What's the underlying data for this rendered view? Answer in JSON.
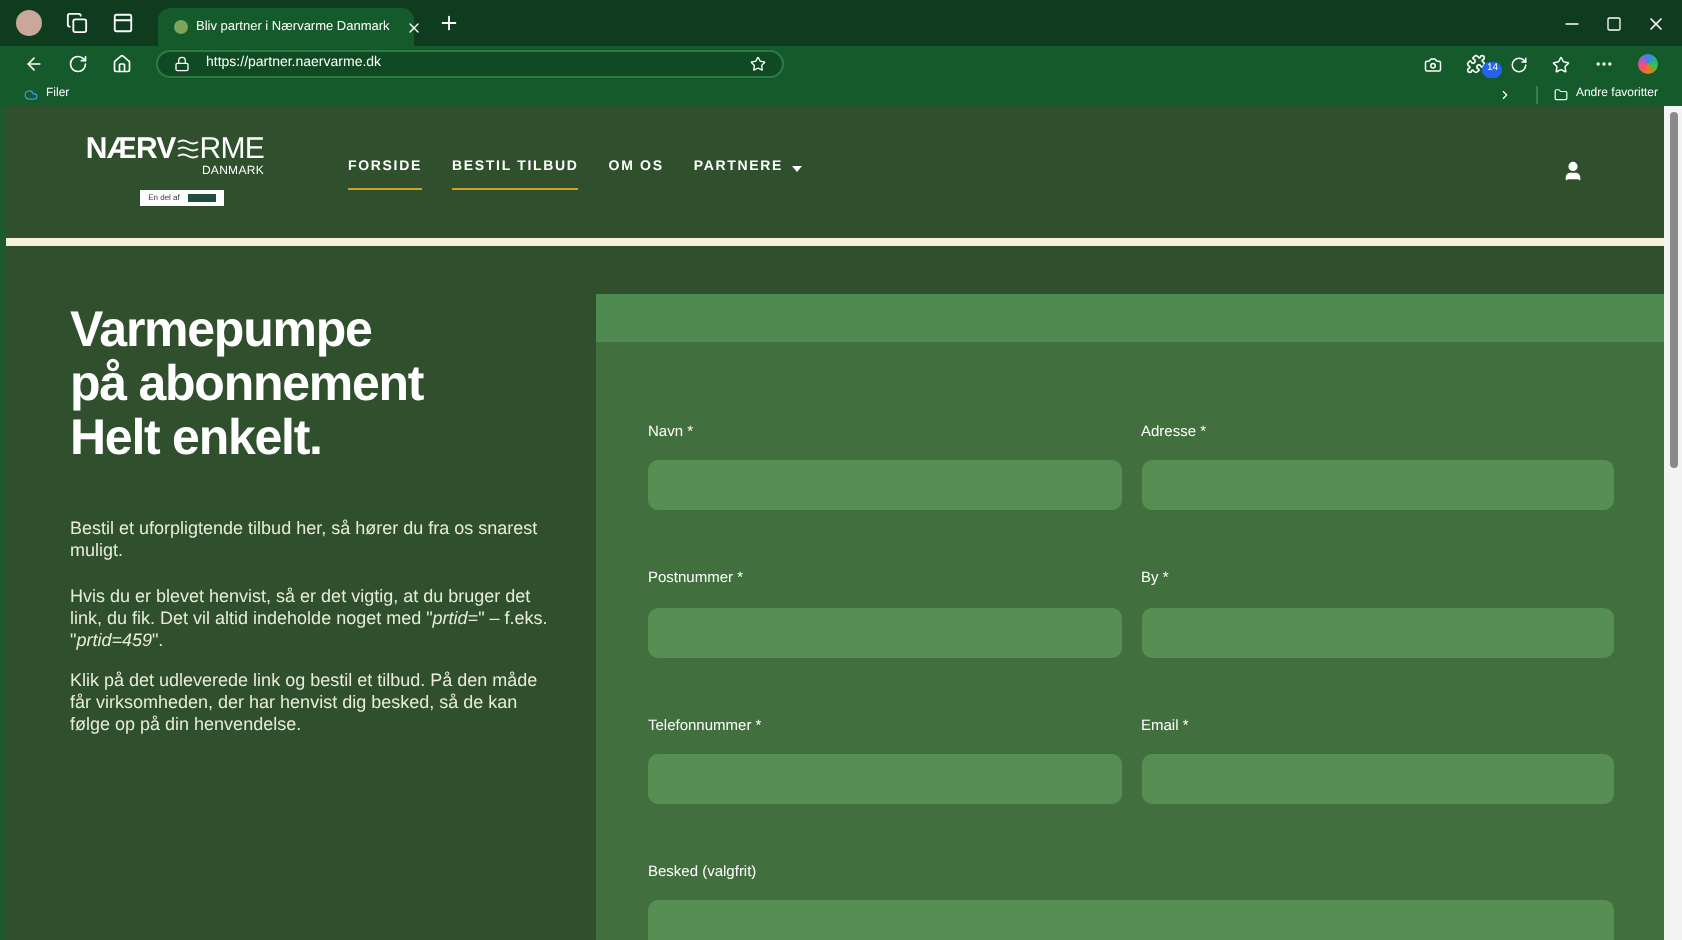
{
  "browser": {
    "tab_title": "Bliv partner i Nærvarme Danmark",
    "url": "https://partner.naervarme.dk",
    "favorites": [
      {
        "label": "Filer"
      }
    ],
    "other_favorites": "Andre favoritter",
    "extension_badge": "14"
  },
  "header": {
    "logo_start": "NÆRV",
    "logo_end": "RME",
    "logo_sub": "DANMARK",
    "logo_badge": "En del af",
    "nav": [
      {
        "label": "FORSIDE",
        "underlined": true,
        "dropdown": false
      },
      {
        "label": "BESTIL TILBUD",
        "underlined": true,
        "dropdown": false
      },
      {
        "label": "OM OS",
        "underlined": false,
        "dropdown": false
      },
      {
        "label": "PARTNERE",
        "underlined": false,
        "dropdown": true
      }
    ]
  },
  "hero": {
    "title_lines": [
      "Varmepumpe",
      "på abonnement",
      "Helt enkelt."
    ],
    "paragraphs": [
      "Bestil et uforpligtende tilbud her, så hører du fra os snarest muligt.",
      "Hvis du er blevet henvist, så er det vigtig, at du bruger det link, du fik. Det vil altid indeholde noget med \"*prtid=*\" – f.eks. \"*prtid=459*\".",
      "Klik på det udleverede link og bestil et tilbud. På den måde får virksomheden, der har henvist dig besked, så de kan følge op på din henvendelse."
    ]
  },
  "form": {
    "fields": [
      {
        "label": "Navn *",
        "kind": "half"
      },
      {
        "label": "Adresse *",
        "kind": "half"
      },
      {
        "label": "Postnummer *",
        "kind": "half"
      },
      {
        "label": "By *",
        "kind": "half"
      },
      {
        "label": "Telefonnummer *",
        "kind": "half"
      },
      {
        "label": "Email *",
        "kind": "half"
      },
      {
        "label": "Besked (valgfrit)",
        "kind": "full"
      }
    ]
  }
}
